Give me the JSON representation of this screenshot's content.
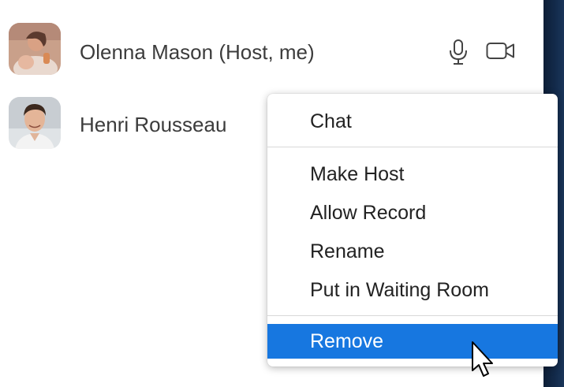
{
  "participants": [
    {
      "name": "Olenna Mason (Host, me)",
      "icons": [
        "microphone-icon",
        "video-camera-icon"
      ]
    },
    {
      "name": "Henri Rousseau",
      "icons": []
    }
  ],
  "context_menu": {
    "items": [
      {
        "label": "Chat"
      },
      {
        "label": "Make Host"
      },
      {
        "label": "Allow Record"
      },
      {
        "label": "Rename"
      },
      {
        "label": "Put in Waiting Room"
      },
      {
        "label": "Remove",
        "highlighted": true
      }
    ]
  },
  "colors": {
    "highlight": "#1777e0",
    "panel_edge": "#132b4c",
    "text": "#3c3c3c"
  }
}
